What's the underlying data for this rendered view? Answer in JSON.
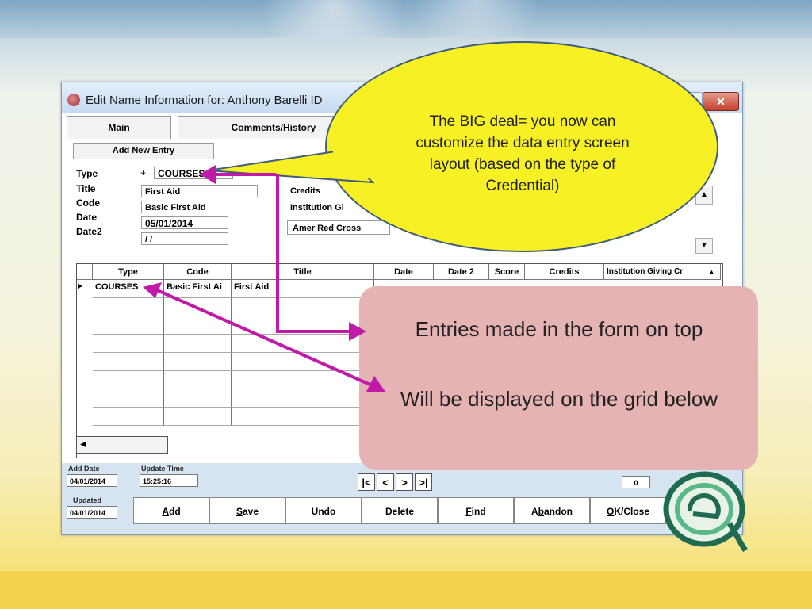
{
  "window": {
    "title": "Edit Name Information for: Anthony Barelli ID"
  },
  "tabs": [
    {
      "label_pre": "",
      "label_u": "M",
      "label_post": "ain"
    },
    {
      "label_pre": "Comments/",
      "label_u": "H",
      "label_post": "istory"
    }
  ],
  "form": {
    "add_new_entry": "Add New Entry",
    "labels": {
      "type": "Type",
      "title": "Title",
      "code": "Code",
      "date": "Date",
      "date2": "Date2",
      "credits": "Credits",
      "institution": "Institution Gi"
    },
    "type_value": "COURSES",
    "type_prefix": "+",
    "title_value": "First Aid",
    "code_value": "Basic First Aid",
    "date_value": "05/01/2014",
    "date2_value": "/ /",
    "institution_value": "Amer Red Cross"
  },
  "grid": {
    "headers": [
      "Type",
      "Code",
      "Title",
      "Date",
      "Date 2",
      "Score",
      "Credits",
      "Institution Giving Cr"
    ],
    "rows": [
      [
        "COURSES",
        "Basic First Ai",
        "First Aid",
        "",
        "",
        "",
        "",
        ""
      ]
    ]
  },
  "bottom": {
    "add_date_label": "Add Date",
    "add_date_value": "04/01/2014",
    "update_time_label": "Update Time",
    "update_time_value": "15:25:16",
    "updated_label": "Updated",
    "updated_value": "04/01/2014",
    "count_value": "0",
    "nav": [
      "|<",
      "<",
      ">",
      ">|"
    ],
    "buttons": [
      {
        "pre": "",
        "u": "A",
        "post": "dd"
      },
      {
        "pre": "",
        "u": "S",
        "post": "ave"
      },
      {
        "pre": "Undo",
        "u": "",
        "post": ""
      },
      {
        "pre": "Delete",
        "u": "",
        "post": ""
      },
      {
        "pre": "",
        "u": "F",
        "post": "ind"
      },
      {
        "pre": "A",
        "u": "b",
        "post": "andon"
      },
      {
        "pre": "",
        "u": "O",
        "post": "K/Close"
      }
    ]
  },
  "callouts": {
    "yellow": "The BIG deal= you now can customize the data entry screen layout (based on the type of Credential)",
    "pink_line1": "Entries made in the form on top",
    "pink_line2": "Will be displayed on the grid below"
  },
  "colors": {
    "arrow": "#c21aa8",
    "yellow_callout": "#f7f025",
    "pink_callout": "#e5b3b3"
  }
}
